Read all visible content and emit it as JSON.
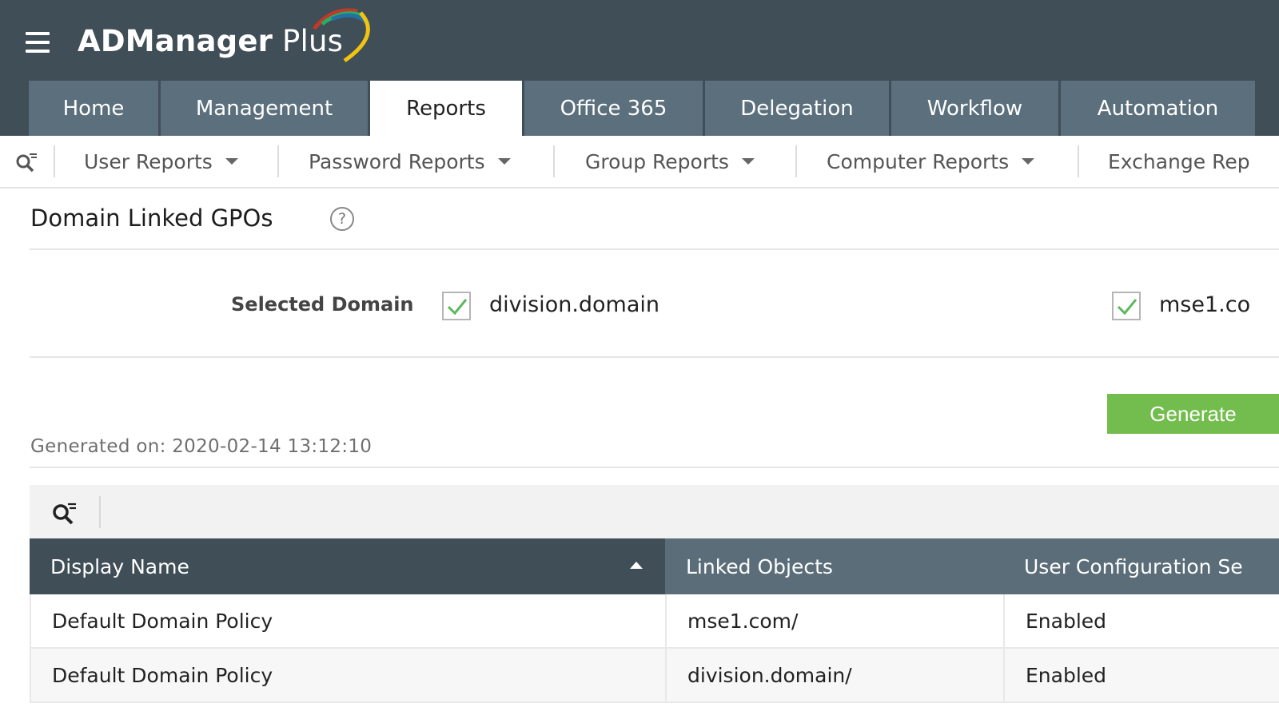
{
  "app": {
    "name_bold": "ADManager",
    "name_light": " Plus"
  },
  "main_tabs": [
    {
      "label": "Home"
    },
    {
      "label": "Management"
    },
    {
      "label": "Reports",
      "active": true
    },
    {
      "label": "Office 365"
    },
    {
      "label": "Delegation"
    },
    {
      "label": "Workflow"
    },
    {
      "label": "Automation"
    }
  ],
  "sub_nav": {
    "items": [
      {
        "label": "User Reports"
      },
      {
        "label": "Password Reports"
      },
      {
        "label": "Group Reports"
      },
      {
        "label": "Computer Reports"
      },
      {
        "label": "Exchange Rep"
      }
    ]
  },
  "page": {
    "title": "Domain Linked GPOs",
    "help_symbol": "?"
  },
  "domain_selection": {
    "label": "Selected Domain",
    "domains": [
      {
        "name": "division.domain",
        "checked": true
      },
      {
        "name": "mse1.co",
        "checked": true
      }
    ]
  },
  "actions": {
    "generate_label": "Generate"
  },
  "report": {
    "generated_on": "Generated on: 2020-02-14 13:12:10"
  },
  "table": {
    "columns": [
      "Display Name",
      "Linked Objects",
      "User Configuration Se"
    ],
    "sorted_column": "Display Name",
    "sort_direction": "ascending",
    "rows": [
      [
        "Default Domain Policy",
        "mse1.com/",
        "Enabled"
      ],
      [
        "Default Domain Policy",
        "division.domain/",
        "Enabled"
      ]
    ]
  },
  "colors": {
    "header_bg": "#404e58",
    "tab_bg": "#5b6f7c",
    "generate_green": "#72bd4d",
    "check_green": "#5cb85c"
  },
  "icons": [
    "menu-icon",
    "search-filter-icon",
    "help-icon",
    "checkmark-icon",
    "caret-down-icon",
    "sort-ascending-icon"
  ]
}
